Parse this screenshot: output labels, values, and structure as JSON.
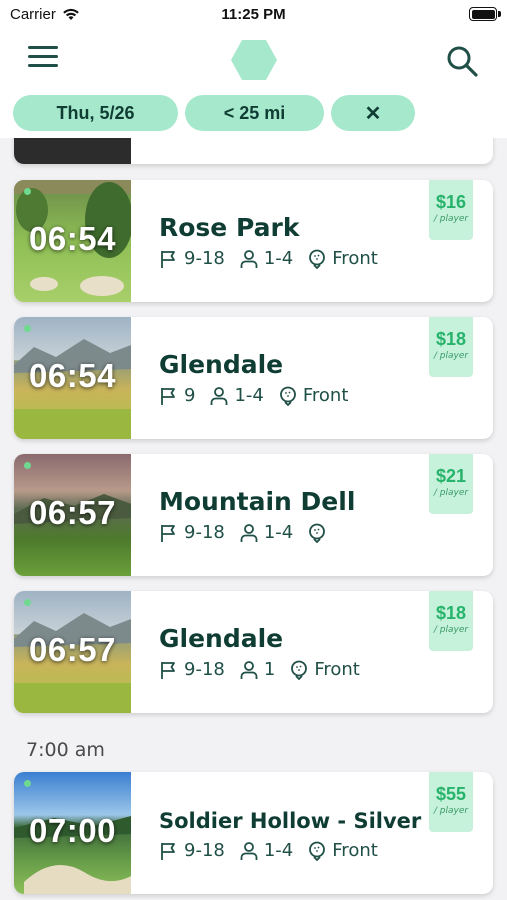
{
  "status_bar": {
    "carrier": "Carrier",
    "time": "11:25 PM"
  },
  "nav": {
    "menu_icon": "hamburger-menu-icon",
    "logo_icon": "hexagon-logo-icon",
    "search_icon": "search-icon"
  },
  "filters": {
    "date": "Thu, 5/26",
    "distance": "< 25 mi",
    "clear": "✕"
  },
  "colors": {
    "accent": "#a6e8cc",
    "brand_dark": "#0f3d33",
    "price_bg": "#c6f1da",
    "price_text": "#27b36b"
  },
  "tee_times": [
    {
      "time": "06:54",
      "course": "Rose Park",
      "holes": "9-18",
      "players": "1-4",
      "start": "Front",
      "price": "$16",
      "per": "/ player"
    },
    {
      "time": "06:54",
      "course": "Glendale",
      "holes": "9",
      "players": "1-4",
      "start": "Front",
      "price": "$18",
      "per": "/ player"
    },
    {
      "time": "06:57",
      "course": "Mountain Dell",
      "holes": "9-18",
      "players": "1-4",
      "start": "",
      "price": "$21",
      "per": "/ player"
    },
    {
      "time": "06:57",
      "course": "Glendale",
      "holes": "9-18",
      "players": "1",
      "start": "Front",
      "price": "$18",
      "per": "/ player"
    }
  ],
  "section_7am": {
    "header": "7:00 am",
    "tee_times": [
      {
        "time": "07:00",
        "course": "Soldier Hollow - Silver",
        "holes": "9-18",
        "players": "1-4",
        "start": "Front",
        "price": "$55",
        "per": "/ player"
      }
    ]
  }
}
